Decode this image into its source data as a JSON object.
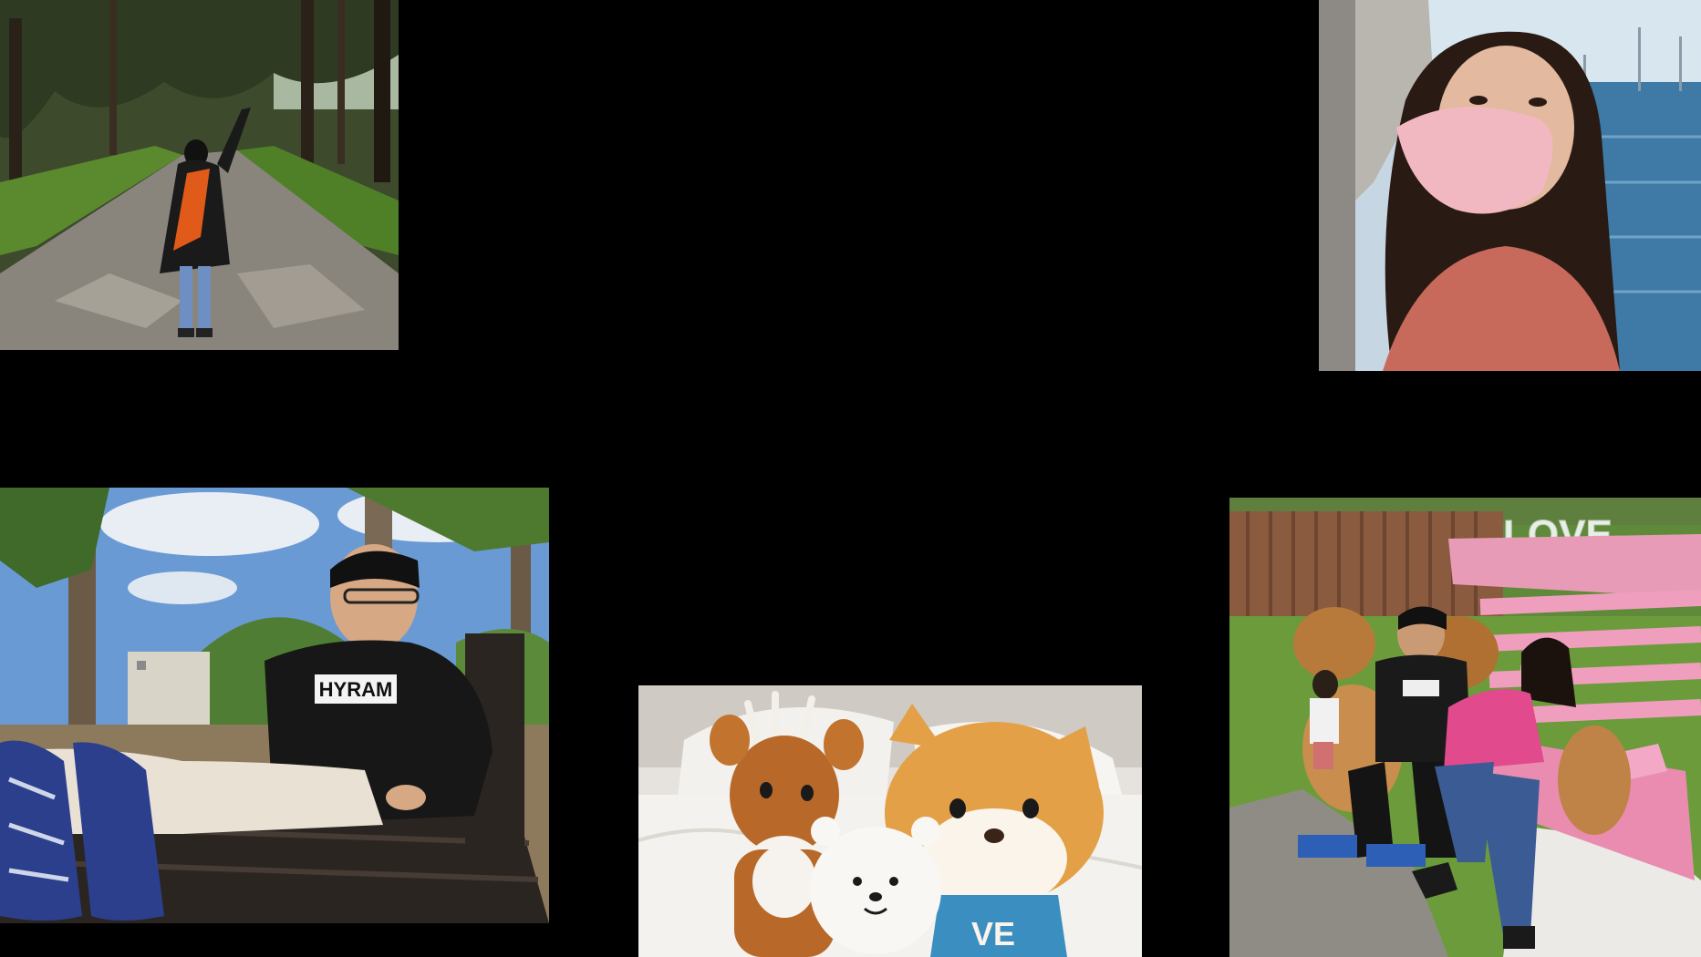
{
  "photos": [
    {
      "id": "park-walk",
      "description_label": ""
    },
    {
      "id": "masked-selfie",
      "description_label": ""
    },
    {
      "id": "man-on-bench",
      "sweater_text": "HYRAM"
    },
    {
      "id": "plush-toys",
      "shirt_text": "VE"
    },
    {
      "id": "family-love-bench",
      "sign_text": "LOVE"
    }
  ],
  "colors": {
    "background": "#000000"
  }
}
